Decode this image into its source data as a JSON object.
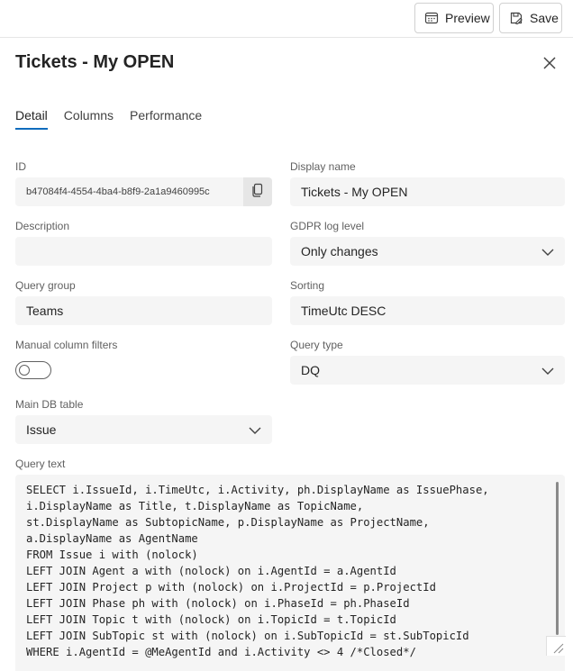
{
  "toolbar": {
    "preview_label": "Preview",
    "save_label": "Save"
  },
  "panel": {
    "title": "Tickets - My OPEN"
  },
  "tabs": [
    {
      "label": "Detail",
      "active": true
    },
    {
      "label": "Columns",
      "active": false
    },
    {
      "label": "Performance",
      "active": false
    }
  ],
  "form": {
    "id": {
      "label": "ID",
      "value": "b47084f4-4554-4ba4-b8f9-2a1a9460995c"
    },
    "display_name": {
      "label": "Display name",
      "value": "Tickets - My OPEN"
    },
    "description": {
      "label": "Description",
      "value": ""
    },
    "gdpr_log_level": {
      "label": "GDPR log level",
      "value": "Only changes"
    },
    "query_group": {
      "label": "Query group",
      "value": "Teams"
    },
    "sorting": {
      "label": "Sorting",
      "value": "TimeUtc DESC"
    },
    "manual_column_filters": {
      "label": "Manual column filters",
      "value": false
    },
    "query_type": {
      "label": "Query type",
      "value": "DQ"
    },
    "main_db_table": {
      "label": "Main DB table",
      "value": "Issue"
    },
    "query_text": {
      "label": "Query text",
      "value": "SELECT i.IssueId, i.TimeUtc, i.Activity, ph.DisplayName as IssuePhase,\ni.DisplayName as Title, t.DisplayName as TopicName,\nst.DisplayName as SubtopicName, p.DisplayName as ProjectName,\na.DisplayName as AgentName\nFROM Issue i with (nolock)\nLEFT JOIN Agent a with (nolock) on i.AgentId = a.AgentId\nLEFT JOIN Project p with (nolock) on i.ProjectId = p.ProjectId\nLEFT JOIN Phase ph with (nolock) on i.PhaseId = ph.PhaseId\nLEFT JOIN Topic t with (nolock) on i.TopicId = t.TopicId\nLEFT JOIN SubTopic st with (nolock) on i.SubTopicId = st.SubTopicId\nWHERE i.AgentId = @MeAgentId and i.Activity <> 4 /*Closed*/"
    }
  },
  "colors": {
    "accent": "#0f6cbd",
    "field_bg": "#f5f5f5"
  }
}
